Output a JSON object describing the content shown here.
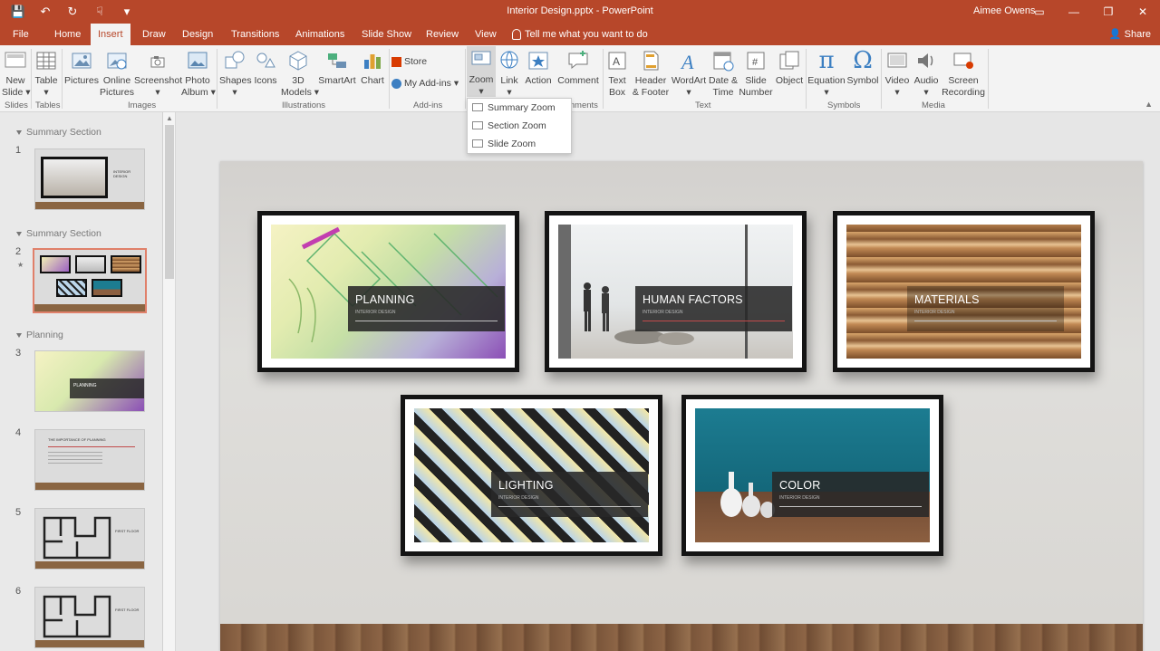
{
  "titlebar": {
    "document_title": "Interior Design.pptx  -  PowerPoint",
    "user_name": "Aimee Owens",
    "qat": [
      {
        "icon": "save-icon",
        "glyph": "💾"
      },
      {
        "icon": "undo-icon",
        "glyph": "↶"
      },
      {
        "icon": "redo-icon",
        "glyph": "↻"
      },
      {
        "icon": "touch-mode-icon",
        "glyph": "☟"
      },
      {
        "icon": "customize-qat-icon",
        "glyph": "▾"
      }
    ],
    "window_controls": [
      {
        "icon": "ribbon-display-icon",
        "glyph": "▭"
      },
      {
        "icon": "minimize-icon",
        "glyph": "—"
      },
      {
        "icon": "restore-icon",
        "glyph": "❐"
      },
      {
        "icon": "close-icon",
        "glyph": "✕"
      }
    ]
  },
  "tabs": [
    "File",
    "Home",
    "Insert",
    "Draw",
    "Design",
    "Transitions",
    "Animations",
    "Slide Show",
    "Review",
    "View"
  ],
  "active_tab": "Insert",
  "tell_me": "Tell me what you want to do",
  "share": "Share",
  "ribbon": {
    "buttons": [
      {
        "id": "new-slide",
        "label": "New\nSlide ▾"
      },
      {
        "id": "table",
        "label": "Table\n▾"
      },
      {
        "id": "pictures",
        "label": "Pictures"
      },
      {
        "id": "online-pictures",
        "label": "Online\nPictures"
      },
      {
        "id": "screenshot",
        "label": "Screenshot\n▾"
      },
      {
        "id": "photo-album",
        "label": "Photo\nAlbum ▾"
      },
      {
        "id": "shapes",
        "label": "Shapes\n▾"
      },
      {
        "id": "icons",
        "label": "Icons"
      },
      {
        "id": "3d-models",
        "label": "3D\nModels ▾"
      },
      {
        "id": "smartart",
        "label": "SmartArt"
      },
      {
        "id": "chart",
        "label": "Chart"
      },
      {
        "id": "zoom",
        "label": "Zoom\n▾"
      },
      {
        "id": "link",
        "label": "Link\n▾"
      },
      {
        "id": "action",
        "label": "Action"
      },
      {
        "id": "comment",
        "label": "Comment"
      },
      {
        "id": "text-box",
        "label": "Text\nBox"
      },
      {
        "id": "header-footer",
        "label": "Header\n& Footer"
      },
      {
        "id": "wordart",
        "label": "WordArt\n▾"
      },
      {
        "id": "date-time",
        "label": "Date &\nTime"
      },
      {
        "id": "slide-number",
        "label": "Slide\nNumber"
      },
      {
        "id": "object",
        "label": "Object"
      },
      {
        "id": "equation",
        "label": "Equation\n▾"
      },
      {
        "id": "symbol",
        "label": "Symbol"
      },
      {
        "id": "video",
        "label": "Video\n▾"
      },
      {
        "id": "audio",
        "label": "Audio\n▾"
      },
      {
        "id": "screen-recording",
        "label": "Screen\nRecording"
      }
    ],
    "store": "Store",
    "my_addins": "My Add-ins",
    "groups": [
      "Slides",
      "Tables",
      "Images",
      "Illustrations",
      "Add-ins",
      "Comments",
      "Text",
      "Symbols",
      "Media"
    ]
  },
  "zoom_menu": [
    "Summary Zoom",
    "Section Zoom",
    "Slide Zoom"
  ],
  "slide_panel": {
    "sections": [
      "Summary Section",
      "Summary Section",
      "Planning"
    ],
    "slides": [
      {
        "num": "1",
        "title": "INTERIOR DESIGN"
      },
      {
        "num": "2",
        "title": ""
      },
      {
        "num": "3",
        "title": "PLANNING"
      },
      {
        "num": "4",
        "title": "THE IMPORTANCE OF PLANNING"
      },
      {
        "num": "5",
        "title": "FIRST FLOOR"
      },
      {
        "num": "6",
        "title": "FIRST FLOOR"
      }
    ]
  },
  "frames": [
    {
      "title": "PLANNING",
      "sub": "INTERIOR DESIGN"
    },
    {
      "title": "HUMAN FACTORS",
      "sub": "INTERIOR DESIGN"
    },
    {
      "title": "MATERIALS",
      "sub": "INTERIOR DESIGN"
    },
    {
      "title": "LIGHTING",
      "sub": "INTERIOR DESIGN"
    },
    {
      "title": "COLOR",
      "sub": "INTERIOR DESIGN"
    }
  ]
}
